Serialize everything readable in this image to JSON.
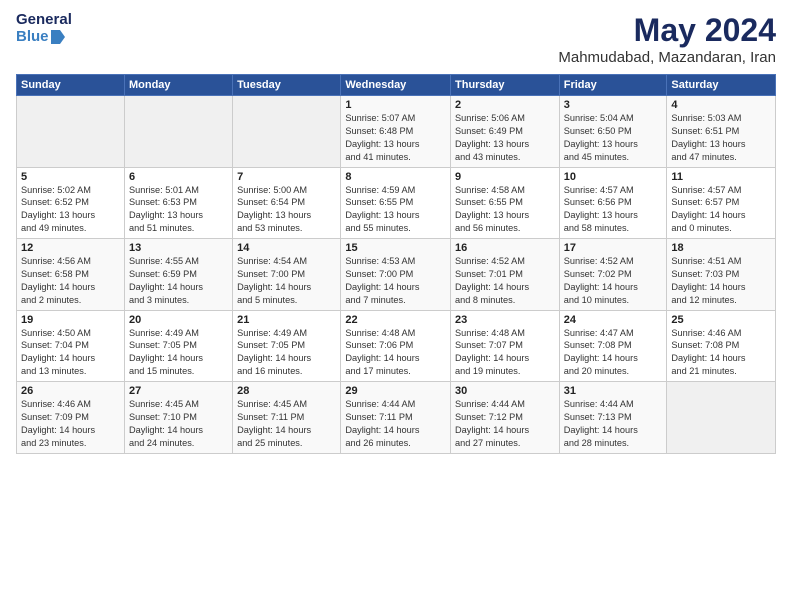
{
  "header": {
    "logo_general": "General",
    "logo_blue": "Blue",
    "main_title": "May 2024",
    "subtitle": "Mahmudabad, Mazandaran, Iran"
  },
  "days_of_week": [
    "Sunday",
    "Monday",
    "Tuesday",
    "Wednesday",
    "Thursday",
    "Friday",
    "Saturday"
  ],
  "weeks": [
    [
      {
        "day": "",
        "info": ""
      },
      {
        "day": "",
        "info": ""
      },
      {
        "day": "",
        "info": ""
      },
      {
        "day": "1",
        "info": "Sunrise: 5:07 AM\nSunset: 6:48 PM\nDaylight: 13 hours\nand 41 minutes."
      },
      {
        "day": "2",
        "info": "Sunrise: 5:06 AM\nSunset: 6:49 PM\nDaylight: 13 hours\nand 43 minutes."
      },
      {
        "day": "3",
        "info": "Sunrise: 5:04 AM\nSunset: 6:50 PM\nDaylight: 13 hours\nand 45 minutes."
      },
      {
        "day": "4",
        "info": "Sunrise: 5:03 AM\nSunset: 6:51 PM\nDaylight: 13 hours\nand 47 minutes."
      }
    ],
    [
      {
        "day": "5",
        "info": "Sunrise: 5:02 AM\nSunset: 6:52 PM\nDaylight: 13 hours\nand 49 minutes."
      },
      {
        "day": "6",
        "info": "Sunrise: 5:01 AM\nSunset: 6:53 PM\nDaylight: 13 hours\nand 51 minutes."
      },
      {
        "day": "7",
        "info": "Sunrise: 5:00 AM\nSunset: 6:54 PM\nDaylight: 13 hours\nand 53 minutes."
      },
      {
        "day": "8",
        "info": "Sunrise: 4:59 AM\nSunset: 6:55 PM\nDaylight: 13 hours\nand 55 minutes."
      },
      {
        "day": "9",
        "info": "Sunrise: 4:58 AM\nSunset: 6:55 PM\nDaylight: 13 hours\nand 56 minutes."
      },
      {
        "day": "10",
        "info": "Sunrise: 4:57 AM\nSunset: 6:56 PM\nDaylight: 13 hours\nand 58 minutes."
      },
      {
        "day": "11",
        "info": "Sunrise: 4:57 AM\nSunset: 6:57 PM\nDaylight: 14 hours\nand 0 minutes."
      }
    ],
    [
      {
        "day": "12",
        "info": "Sunrise: 4:56 AM\nSunset: 6:58 PM\nDaylight: 14 hours\nand 2 minutes."
      },
      {
        "day": "13",
        "info": "Sunrise: 4:55 AM\nSunset: 6:59 PM\nDaylight: 14 hours\nand 3 minutes."
      },
      {
        "day": "14",
        "info": "Sunrise: 4:54 AM\nSunset: 7:00 PM\nDaylight: 14 hours\nand 5 minutes."
      },
      {
        "day": "15",
        "info": "Sunrise: 4:53 AM\nSunset: 7:00 PM\nDaylight: 14 hours\nand 7 minutes."
      },
      {
        "day": "16",
        "info": "Sunrise: 4:52 AM\nSunset: 7:01 PM\nDaylight: 14 hours\nand 8 minutes."
      },
      {
        "day": "17",
        "info": "Sunrise: 4:52 AM\nSunset: 7:02 PM\nDaylight: 14 hours\nand 10 minutes."
      },
      {
        "day": "18",
        "info": "Sunrise: 4:51 AM\nSunset: 7:03 PM\nDaylight: 14 hours\nand 12 minutes."
      }
    ],
    [
      {
        "day": "19",
        "info": "Sunrise: 4:50 AM\nSunset: 7:04 PM\nDaylight: 14 hours\nand 13 minutes."
      },
      {
        "day": "20",
        "info": "Sunrise: 4:49 AM\nSunset: 7:05 PM\nDaylight: 14 hours\nand 15 minutes."
      },
      {
        "day": "21",
        "info": "Sunrise: 4:49 AM\nSunset: 7:05 PM\nDaylight: 14 hours\nand 16 minutes."
      },
      {
        "day": "22",
        "info": "Sunrise: 4:48 AM\nSunset: 7:06 PM\nDaylight: 14 hours\nand 17 minutes."
      },
      {
        "day": "23",
        "info": "Sunrise: 4:48 AM\nSunset: 7:07 PM\nDaylight: 14 hours\nand 19 minutes."
      },
      {
        "day": "24",
        "info": "Sunrise: 4:47 AM\nSunset: 7:08 PM\nDaylight: 14 hours\nand 20 minutes."
      },
      {
        "day": "25",
        "info": "Sunrise: 4:46 AM\nSunset: 7:08 PM\nDaylight: 14 hours\nand 21 minutes."
      }
    ],
    [
      {
        "day": "26",
        "info": "Sunrise: 4:46 AM\nSunset: 7:09 PM\nDaylight: 14 hours\nand 23 minutes."
      },
      {
        "day": "27",
        "info": "Sunrise: 4:45 AM\nSunset: 7:10 PM\nDaylight: 14 hours\nand 24 minutes."
      },
      {
        "day": "28",
        "info": "Sunrise: 4:45 AM\nSunset: 7:11 PM\nDaylight: 14 hours\nand 25 minutes."
      },
      {
        "day": "29",
        "info": "Sunrise: 4:44 AM\nSunset: 7:11 PM\nDaylight: 14 hours\nand 26 minutes."
      },
      {
        "day": "30",
        "info": "Sunrise: 4:44 AM\nSunset: 7:12 PM\nDaylight: 14 hours\nand 27 minutes."
      },
      {
        "day": "31",
        "info": "Sunrise: 4:44 AM\nSunset: 7:13 PM\nDaylight: 14 hours\nand 28 minutes."
      },
      {
        "day": "",
        "info": ""
      }
    ]
  ]
}
